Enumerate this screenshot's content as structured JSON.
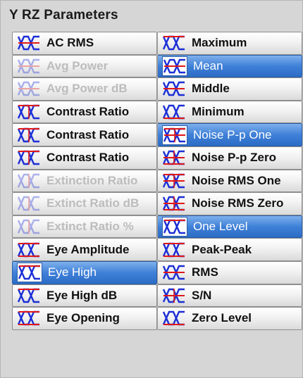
{
  "panel": {
    "title": "Y RZ Parameters"
  },
  "left_items": [
    {
      "label": "AC RMS",
      "icon": "ac-rms-icon",
      "state": "normal"
    },
    {
      "label": "Avg Power",
      "icon": "avg-power-icon",
      "state": "disabled"
    },
    {
      "label": "Avg Power dB",
      "icon": "avg-power-db-icon",
      "state": "disabled"
    },
    {
      "label": "Contrast Ratio",
      "icon": "contrast-ratio-icon",
      "state": "normal"
    },
    {
      "label": "Contrast Ratio",
      "icon": "contrast-ratio-icon",
      "state": "normal"
    },
    {
      "label": "Contrast Ratio",
      "icon": "contrast-ratio-icon",
      "state": "normal"
    },
    {
      "label": "Extinction Ratio",
      "icon": "extinction-ratio-icon",
      "state": "disabled"
    },
    {
      "label": "Extinct Ratio dB",
      "icon": "extinct-ratio-db-icon",
      "state": "disabled"
    },
    {
      "label": "Extinct Ratio %",
      "icon": "extinct-ratio-percent-icon",
      "state": "disabled"
    },
    {
      "label": "Eye Amplitude",
      "icon": "eye-amplitude-icon",
      "state": "normal"
    },
    {
      "label": "Eye High",
      "icon": "eye-high-icon",
      "state": "selected"
    },
    {
      "label": "Eye High dB",
      "icon": "eye-high-db-icon",
      "state": "normal"
    },
    {
      "label": "Eye Opening",
      "icon": "eye-opening-icon",
      "state": "normal"
    }
  ],
  "right_items": [
    {
      "label": "Maximum",
      "icon": "maximum-icon",
      "state": "normal"
    },
    {
      "label": "Mean",
      "icon": "mean-icon",
      "state": "selected"
    },
    {
      "label": "Middle",
      "icon": "middle-icon",
      "state": "normal"
    },
    {
      "label": "Minimum",
      "icon": "minimum-icon",
      "state": "normal"
    },
    {
      "label": "Noise P-p One",
      "icon": "noise-pp-one-icon",
      "state": "selected"
    },
    {
      "label": "Noise P-p Zero",
      "icon": "noise-pp-zero-icon",
      "state": "normal"
    },
    {
      "label": "Noise RMS One",
      "icon": "noise-rms-one-icon",
      "state": "normal"
    },
    {
      "label": "Noise RMS Zero",
      "icon": "noise-rms-zero-icon",
      "state": "normal"
    },
    {
      "label": "One Level",
      "icon": "one-level-icon",
      "state": "selected"
    },
    {
      "label": "Peak-Peak",
      "icon": "peak-peak-icon",
      "state": "normal"
    },
    {
      "label": "RMS",
      "icon": "rms-icon",
      "state": "normal"
    },
    {
      "label": "S/N",
      "icon": "signal-to-noise-icon",
      "state": "normal"
    },
    {
      "label": "Zero Level",
      "icon": "zero-level-icon",
      "state": "normal"
    }
  ],
  "colors": {
    "selected_top": "#7fb0ec",
    "selected_bottom": "#2c6cc6",
    "icon_wave": "#1c2fd6",
    "icon_marker": "#e01818",
    "disabled_text": "#bcbcbc"
  }
}
